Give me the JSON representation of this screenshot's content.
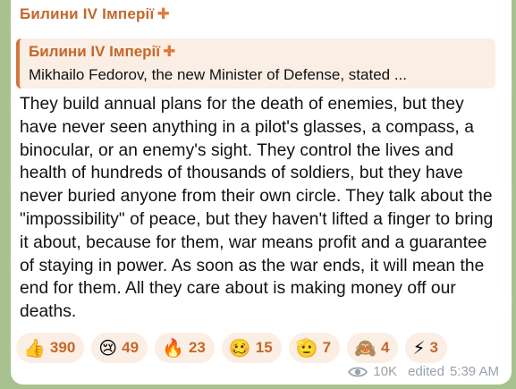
{
  "message": {
    "channel_name": "Билини IV Імперії",
    "channel_symbol": "✚",
    "reply": {
      "title": "Билини IV Імперії",
      "title_symbol": "✚",
      "preview": "Mikhailo Fedorov, the new Minister of Defense, stated ..."
    },
    "text": "They build annual plans for the death of enemies, but they have never seen anything in a pilot's glasses, a compass, a binocular, or an enemy's sight. They control the lives and health of hundreds of thousands of soldiers, but they have never buried anyone from their own circle. They talk about the \"impossibility\" of peace, but they haven't lifted a finger to bring it about, because for them, war means profit and a guarantee of staying in power. As soon as the war ends, it will mean the end for them. All they care about is making money off our deaths.",
    "reactions": [
      {
        "emoji": "👍",
        "icon": "thumbs-up",
        "count": "390"
      },
      {
        "emoji": "😢",
        "icon": "crying-face",
        "count": "49"
      },
      {
        "emoji": "🔥",
        "icon": "fire",
        "count": "23"
      },
      {
        "emoji": "🥴",
        "icon": "woozy-face",
        "count": "15"
      },
      {
        "emoji": "🫡",
        "icon": "saluting-face",
        "count": "7"
      },
      {
        "emoji": "🙈",
        "icon": "see-no-evil-monkey",
        "count": "4"
      },
      {
        "emoji": "⚡",
        "icon": "high-voltage",
        "count": "3"
      }
    ],
    "views": "10K",
    "edited_label": "edited",
    "time": "5:39 AM"
  },
  "colors": {
    "accent": "#c4672b",
    "reply_bg": "#fbeee4",
    "chat_bg": "#a9c08f",
    "meta": "#9aa3ad"
  }
}
